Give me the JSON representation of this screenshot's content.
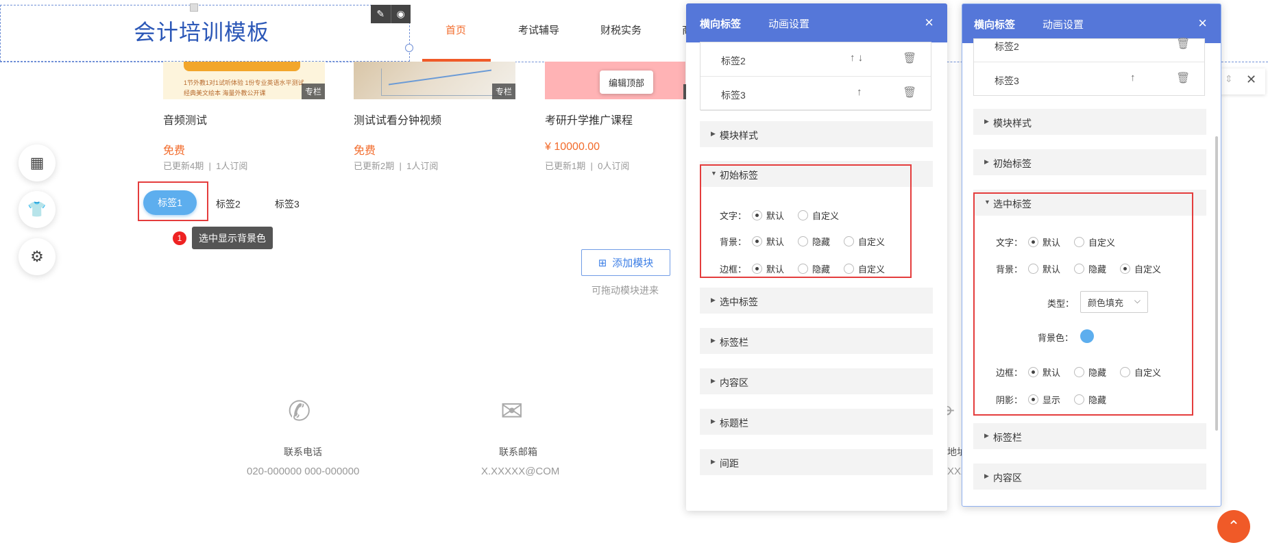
{
  "header": {
    "site_title": "会计培训模板",
    "nav": [
      "首页",
      "考试辅导",
      "财税实务",
      "商"
    ]
  },
  "courses": [
    {
      "title": "音频测试",
      "price": "免费",
      "updated": "已更新4期",
      "subs": "1人订阅",
      "tag": "专栏",
      "promo_lines": [
        "1节外教1对1试听体验  1份专业英语水平测试",
        "经典美文绘本     海量外教公开课"
      ]
    },
    {
      "title": "测试试看分钟视频",
      "price": "免费",
      "updated": "已更新2期",
      "subs": "1人订阅",
      "tag": "专栏"
    },
    {
      "title": "考研升学推广课程",
      "price": "¥ 10000.00",
      "updated": "已更新1期",
      "subs": "0人订阅"
    }
  ],
  "edit_top_label": "编辑顶部",
  "meta_sep": "|",
  "tabs": [
    "标签1",
    "标签2",
    "标签3"
  ],
  "tooltip": {
    "badge": "1",
    "text": "选中显示背景色"
  },
  "add_module": {
    "label": "添加模块",
    "hint": "可拖动模块进来"
  },
  "footer": [
    {
      "label": "联系电话",
      "value": "020-000000 000-000000",
      "icon": "phone-icon"
    },
    {
      "label": "联系邮箱",
      "value": "X.XXXXX@COM",
      "icon": "mail-icon"
    },
    {
      "label": "地址",
      "value": "XXX",
      "icon": "location-icon"
    }
  ],
  "panel1": {
    "tabs": [
      "横向标签",
      "动画设置"
    ],
    "list": [
      {
        "label": "标签2",
        "arrows": "↑ ↓"
      },
      {
        "label": "标签3",
        "arrows": "↑"
      }
    ],
    "sections": [
      "模块样式",
      "初始标签",
      "选中标签",
      "标签栏",
      "内容区",
      "标题栏",
      "间距"
    ],
    "form": {
      "text_label": "文字：",
      "text_opts": [
        "默认",
        "自定义"
      ],
      "bg_label": "背景：",
      "bg_opts": [
        "默认",
        "隐藏",
        "自定义"
      ],
      "border_label": "边框：",
      "border_opts": [
        "默认",
        "隐藏",
        "自定义"
      ]
    }
  },
  "panel2": {
    "tabs": [
      "横向标签",
      "动画设置"
    ],
    "list": [
      {
        "label": "标签2"
      },
      {
        "label": "标签3",
        "arrows": "↑"
      }
    ],
    "sections": [
      "模块样式",
      "初始标签",
      "选中标签",
      "标签栏",
      "内容区"
    ],
    "form": {
      "text_label": "文字：",
      "text_opts": [
        "默认",
        "自定义"
      ],
      "bg_label": "背景：",
      "bg_opts": [
        "默认",
        "隐藏",
        "自定义"
      ],
      "type_label": "类型：",
      "type_value": "颜色填充",
      "bgcolor_label": "背景色：",
      "bgcolor": "#5daeee",
      "border_label": "边框：",
      "border_opts": [
        "默认",
        "隐藏",
        "自定义"
      ],
      "shadow_label": "阴影：",
      "shadow_opts": [
        "显示",
        "隐藏"
      ]
    }
  },
  "colors": {
    "accent": "#5577d9",
    "orange": "#f26b2b",
    "highlight": "#e43c3c",
    "tab_bg": "#5daeee"
  }
}
